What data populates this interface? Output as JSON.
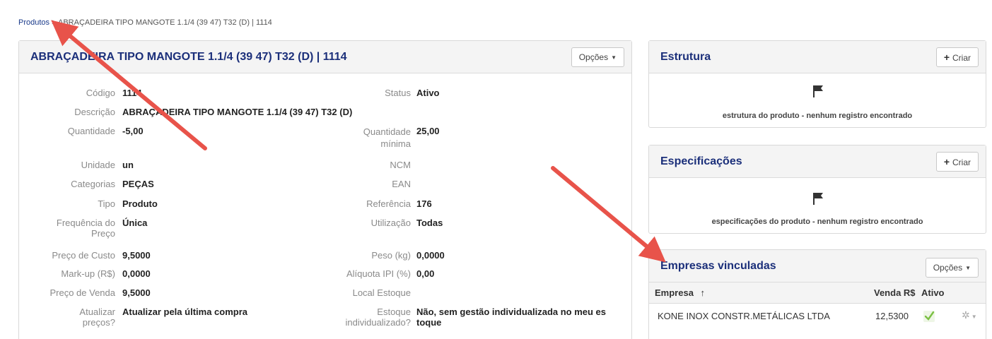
{
  "breadcrumb": {
    "root": "Produtos",
    "separator": ">",
    "current": "ABRAÇADEIRA TIPO MANGOTE 1.1/4 (39 47) T32 (D) | 1114"
  },
  "main": {
    "title": "ABRAÇADEIRA TIPO MANGOTE 1.1/4 (39 47) T32 (D) | 1114",
    "options_label": "Opções",
    "fields": {
      "codigo": {
        "label": "Código",
        "value": "1114"
      },
      "status": {
        "label": "Status",
        "value": "Ativo"
      },
      "descricao": {
        "label": "Descrição",
        "value": "ABRAÇADEIRA TIPO MANGOTE 1.1/4 (39 47) T32 (D)"
      },
      "quantidade": {
        "label": "Quantidade",
        "value": "-5,00"
      },
      "quantidade_minima": {
        "label_1": "Quantidade",
        "label_2": "mínima",
        "value": "25,00"
      },
      "unidade": {
        "label": "Unidade",
        "value": "un"
      },
      "ncm": {
        "label": "NCM",
        "value": ""
      },
      "categorias": {
        "label": "Categorias",
        "value": "PEÇAS"
      },
      "ean": {
        "label": "EAN",
        "value": ""
      },
      "tipo": {
        "label": "Tipo",
        "value": "Produto"
      },
      "referencia": {
        "label": "Referência",
        "value": "176"
      },
      "frequencia": {
        "label_1": "Frequência do",
        "label_2": "Preço",
        "value": "Única"
      },
      "utilizacao": {
        "label": "Utilização",
        "value": "Todas"
      },
      "preco_custo": {
        "label": "Preço de Custo",
        "value": "9,5000"
      },
      "peso": {
        "label": "Peso (kg)",
        "value": "0,0000"
      },
      "markup": {
        "label": "Mark-up (R$)",
        "value": "0,0000"
      },
      "aliquota_ipi": {
        "label": "Alíquota IPI (%)",
        "value": "0,00"
      },
      "preco_venda": {
        "label": "Preço de Venda",
        "value": "9,5000"
      },
      "local_estoque": {
        "label": "Local Estoque",
        "value": ""
      },
      "atualizar_precos": {
        "label_1": "Atualizar",
        "label_2": "preços?",
        "value": "Atualizar pela última compra"
      },
      "estoque_indiv": {
        "label_1": "Estoque",
        "label_2": "individualizado?",
        "value_1": "Não, sem gestão individualizada no meu es",
        "value_2": "toque"
      }
    }
  },
  "estrutura": {
    "title": "Estrutura",
    "create_label": "Criar",
    "empty_text": "estrutura do produto - nenhum registro encontrado"
  },
  "especificacoes": {
    "title": "Especificações",
    "create_label": "Criar",
    "empty_text": "especificações do produto - nenhum registro encontrado"
  },
  "empresas": {
    "title": "Empresas vinculadas",
    "options_label": "Opções",
    "columns": {
      "empresa": "Empresa",
      "sort_indicator": "↑",
      "venda": "Venda R$",
      "ativo": "Ativo"
    },
    "rows": [
      {
        "empresa": "KONE INOX CONSTR.METÁLICAS LTDA",
        "venda": "12,5300",
        "ativo": true
      }
    ]
  },
  "colors": {
    "title": "#1b2f7a",
    "arrow": "#e8534a",
    "link": "#1a3a8a"
  }
}
